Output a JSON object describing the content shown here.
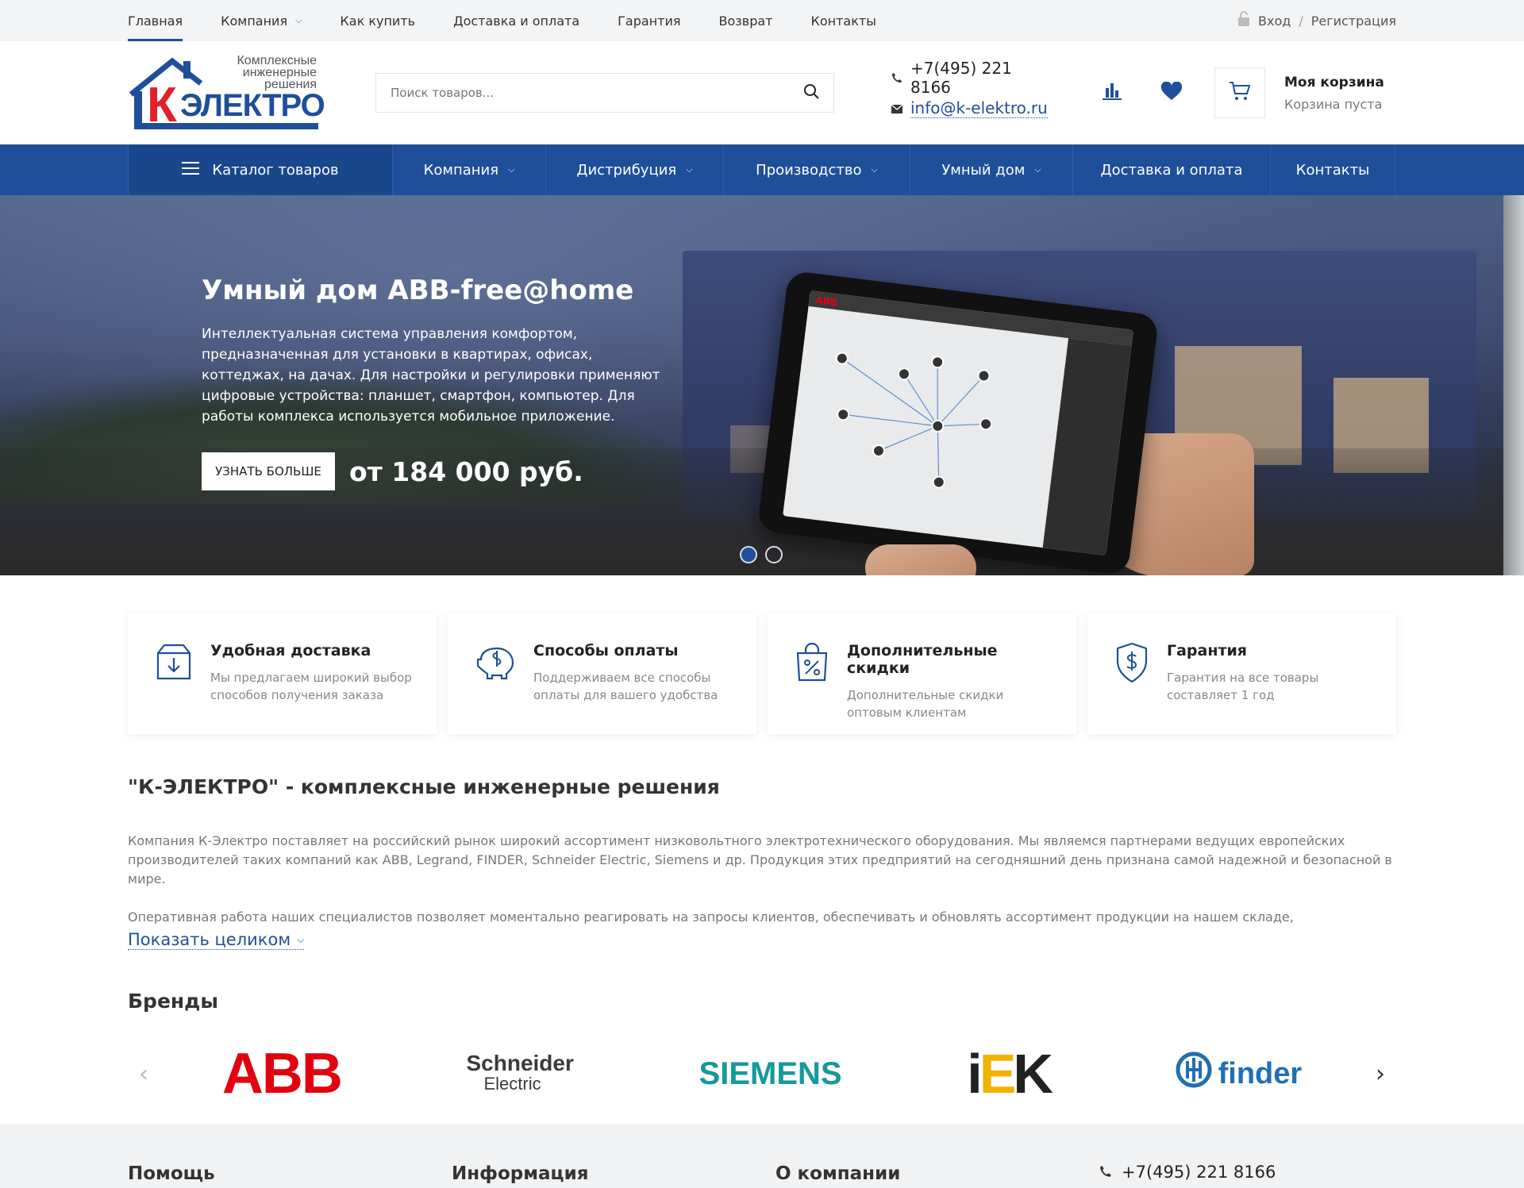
{
  "topnav": {
    "items": [
      {
        "label": "Главная",
        "active": true
      },
      {
        "label": "Компания",
        "dropdown": true
      },
      {
        "label": "Как купить"
      },
      {
        "label": "Доставка и оплата"
      },
      {
        "label": "Гарантия"
      },
      {
        "label": "Возврат"
      },
      {
        "label": "Контакты"
      }
    ],
    "login": "Вход",
    "sep": "/",
    "register": "Регистрация"
  },
  "logo": {
    "tagline_1": "Комплексные",
    "tagline_2": "инженерные",
    "tagline_3": "решения",
    "letter": "К",
    "name": "ЭЛЕКТРО"
  },
  "search": {
    "placeholder": "Поиск товаров..."
  },
  "contacts": {
    "phone": "+7(495) 221 8166",
    "email": "info@k-elektro.ru"
  },
  "cart": {
    "title": "Моя корзина",
    "status": "Корзина пуста"
  },
  "mainnav": {
    "items": [
      {
        "label": "Каталог товаров"
      },
      {
        "label": "Компания"
      },
      {
        "label": "Дистрибуция"
      },
      {
        "label": "Производство"
      },
      {
        "label": "Умный дом"
      },
      {
        "label": "Доставка и оплата"
      },
      {
        "label": "Контакты"
      }
    ]
  },
  "hero": {
    "title": "Умный дом ABB-free@home",
    "description": "Интеллектуальная система управления комфортом, предназначенная для установки в квартирах, офисах, коттеджах, на дачах. Для настройки и регулировки применяют цифровые устройства: планшет, смартфон, компьютер. Для работы комплекса используется мобильное приложение.",
    "button": "УЗНАТЬ БОЛЬШЕ",
    "price": "от 184 000 руб.",
    "tablet_brand": "ABB",
    "slides": 2,
    "active_slide": 1
  },
  "features": [
    {
      "title": "Удобная доставка",
      "text": "Мы предлагаем широкий выбор способов получения заказа",
      "icon": "box-download-icon"
    },
    {
      "title": "Способы оплаты",
      "text": "Поддерживаем все способы оплаты для вашего удобства",
      "icon": "piggy-bank-icon"
    },
    {
      "title": "Дополнительные скидки",
      "text": "Дополнительные скидки оптовым клиентам",
      "icon": "discount-bag-icon"
    },
    {
      "title": "Гарантия",
      "text": "Гарантия на все товары составляет 1 год",
      "icon": "shield-dollar-icon"
    }
  ],
  "about": {
    "title": "\"К-ЭЛЕКТРО\" - комплексные инженерные решения",
    "p1": "Компания К-Электро поставляет на российский рынок широкий ассортимент низковольтного электротехнического оборудования. Мы являемся партнерами ведущих европейских производителей таких компаний как ABB, Legrand, FINDER, Schneider Electric, Siemens и др. Продукция этих предприятий на сегодняшний день признана самой надежной и безопасной в мире.",
    "p2": "Оперативная работа наших специалистов позволяет моментально реагировать на запросы клиентов, обеспечивать и обновлять ассортимент продукции на нашем складе, насчитывающем",
    "show_all": "Показать целиком"
  },
  "brands": {
    "title": "Бренды",
    "abb": "ABB",
    "schneider_1": "Schneider",
    "schneider_2": "Electric",
    "siemens": "SIEMENS",
    "iek_i": "i",
    "iek_e": "E",
    "iek_k": "K",
    "finder": "finder"
  },
  "footer": {
    "col1": "Помощь",
    "col2": "Информация",
    "col3": "О компании",
    "phone": "+7(495) 221 8166"
  },
  "colors": {
    "brand": "#1f4f9a",
    "abb_red": "#e3000f",
    "siemens_teal": "#159a9c"
  }
}
